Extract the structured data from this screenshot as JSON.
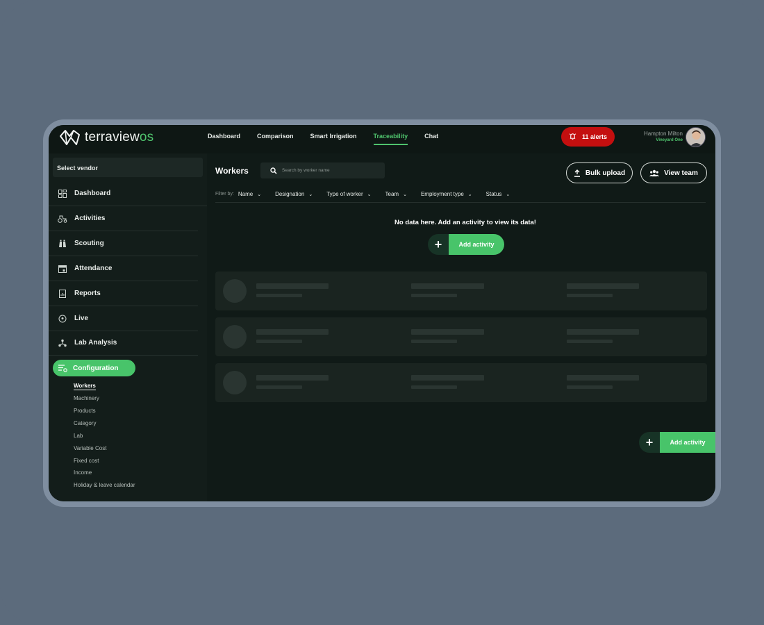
{
  "app": {
    "logo_text": "terraview",
    "logo_suffix": "os"
  },
  "nav": {
    "items": [
      {
        "label": "Dashboard"
      },
      {
        "label": "Comparison"
      },
      {
        "label": "Smart Irrigation"
      },
      {
        "label": "Traceability",
        "active": true
      },
      {
        "label": "Chat"
      }
    ]
  },
  "alerts": {
    "label": "11 alerts",
    "color": "#c40f0f"
  },
  "user": {
    "name": "Hampton Milton",
    "subtitle": "Vineyard One"
  },
  "sidebar": {
    "vendor_label": "Select vendor",
    "items": [
      {
        "label": "Dashboard",
        "icon": "dashboard-icon"
      },
      {
        "label": "Activities",
        "icon": "tractor-icon"
      },
      {
        "label": "Scouting",
        "icon": "binoculars-icon"
      },
      {
        "label": "Attendance",
        "icon": "calendar-icon"
      },
      {
        "label": "Reports",
        "icon": "report-icon"
      },
      {
        "label": "Live",
        "icon": "location-icon"
      },
      {
        "label": "Lab Analysis",
        "icon": "network-icon"
      }
    ],
    "config_label": "Configuration",
    "sub_items": [
      {
        "label": "Workers",
        "active": true
      },
      {
        "label": "Machinery"
      },
      {
        "label": "Products"
      },
      {
        "label": "Category"
      },
      {
        "label": "Lab"
      },
      {
        "label": "Variable Cost"
      },
      {
        "label": "Fixed cost"
      },
      {
        "label": "Income"
      },
      {
        "label": "Holiday & leave calendar"
      }
    ]
  },
  "main": {
    "title": "Workers",
    "search_placeholder": "Search by worker name",
    "bulk_upload_label": "Bulk upload",
    "view_team_label": "View team",
    "filter_by_label": "Filter by:",
    "filters": [
      {
        "label": "Name"
      },
      {
        "label": "Designation"
      },
      {
        "label": "Type of worker"
      },
      {
        "label": "Team"
      },
      {
        "label": "Employment type"
      },
      {
        "label": "Status"
      }
    ],
    "empty_message": "No data here. Add an activity to view its data!",
    "add_activity_label": "Add activity",
    "floating_add_label": "Add activity"
  },
  "colors": {
    "accent": "#48c46a",
    "background": "#101a17"
  }
}
